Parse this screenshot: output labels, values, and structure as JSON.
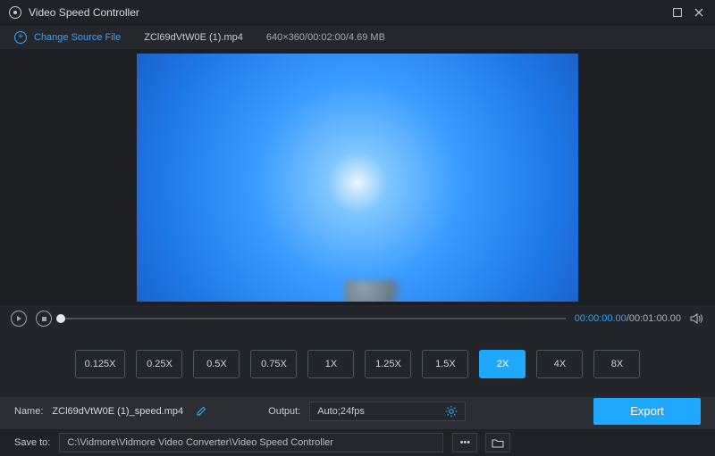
{
  "app": {
    "title": "Video Speed Controller"
  },
  "source": {
    "change_label": "Change Source File",
    "filename": "ZCl69dVtW0E (1).mp4",
    "meta": "640×360/00:02:00/4.69 MB"
  },
  "playback": {
    "current": "00:00:00.00",
    "total": "00:01:00.00"
  },
  "speeds": {
    "options": [
      "0.125X",
      "0.25X",
      "0.5X",
      "0.75X",
      "1X",
      "1.25X",
      "1.5X",
      "2X",
      "4X",
      "8X"
    ],
    "active_index": 7
  },
  "name": {
    "label": "Name:",
    "value": "ZCl69dVtW0E (1)_speed.mp4"
  },
  "output": {
    "label": "Output:",
    "value": "Auto;24fps"
  },
  "export": {
    "label": "Export"
  },
  "save": {
    "label": "Save to:",
    "path": "C:\\Vidmore\\Vidmore Video Converter\\Video Speed Controller"
  }
}
